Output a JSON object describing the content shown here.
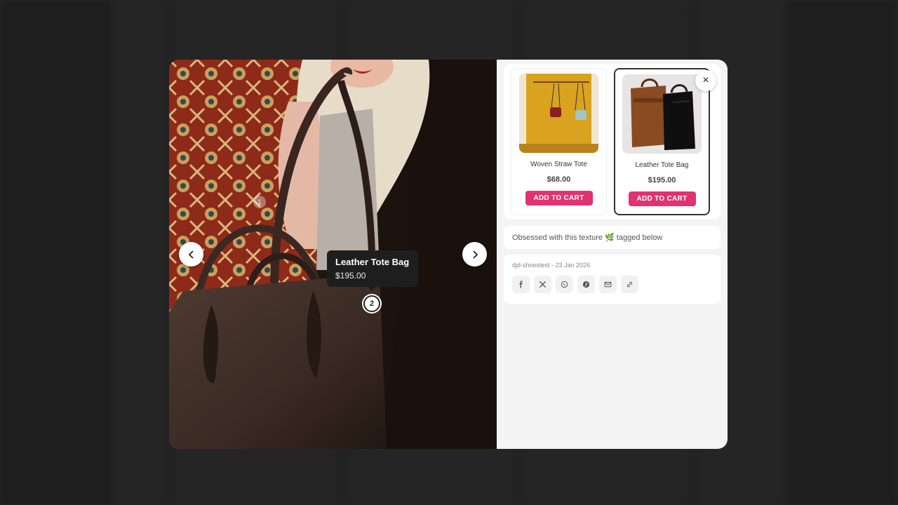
{
  "photo": {
    "hotspots": [
      "1",
      "2"
    ],
    "tooltip": {
      "name": "Leather Tote Bag",
      "price": "$195.00"
    }
  },
  "products": [
    {
      "name": "Woven Straw Tote",
      "price": "$68.00",
      "cta": "ADD TO CART"
    },
    {
      "name": "Leather Tote Bag",
      "price": "$195.00",
      "cta": "ADD TO CART",
      "selected": true
    }
  ],
  "close_label": "×",
  "caption": "Obsessed with this texture 🌿 tagged below",
  "meta": "djd-shoestest - 23 Jan 2026",
  "share_icons": [
    "facebook-icon",
    "x-icon",
    "whatsapp-icon",
    "pinterest-icon",
    "email-icon",
    "link-icon"
  ],
  "colors": {
    "accent": "#e0336f",
    "tooltip_bg": "#1e1e1e",
    "panel_bg": "#f4f4f4"
  }
}
